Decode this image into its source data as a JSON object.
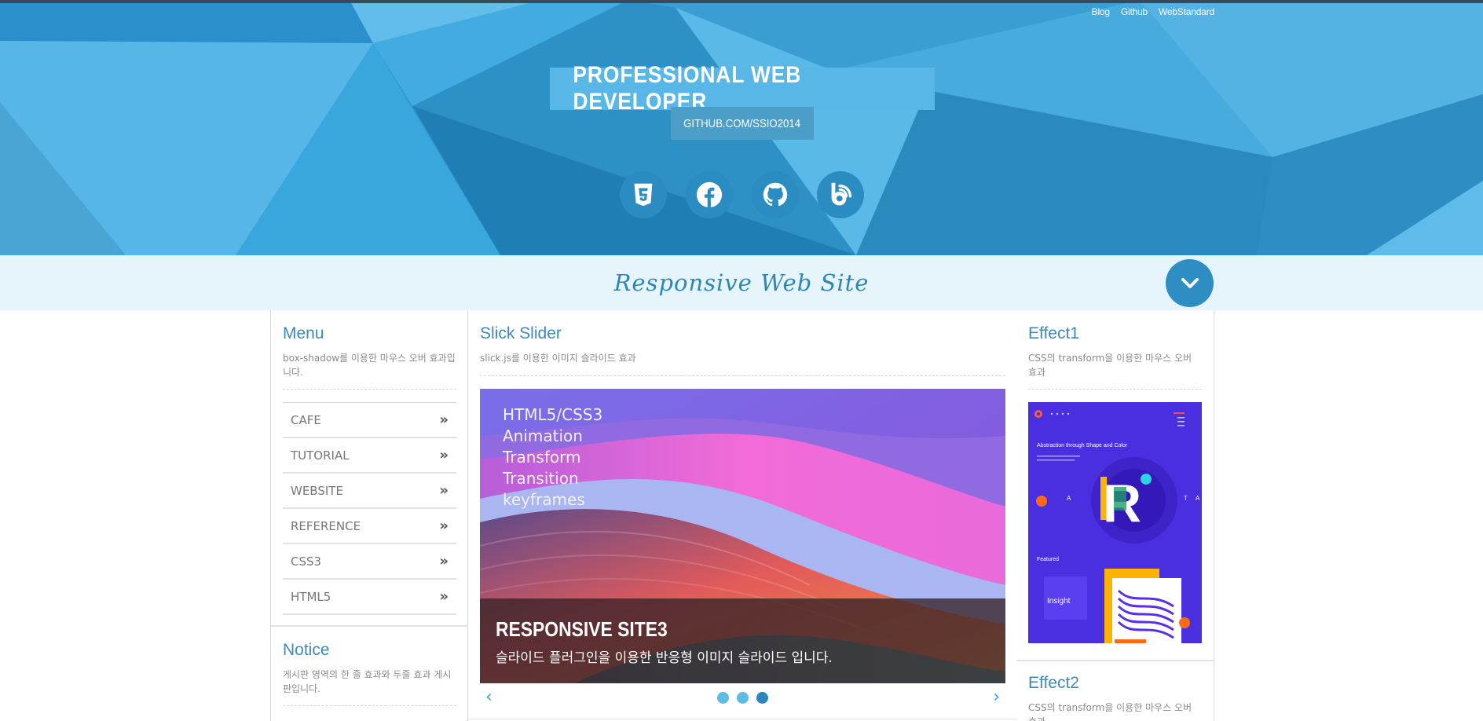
{
  "top_links": [
    "Blog",
    "Github",
    "WebStandard"
  ],
  "header": {
    "title": "PROFESSIONAL WEB DEVELOPER",
    "subtitle": "GITHUB.COM/SSIO2014",
    "social": [
      "html5-icon",
      "facebook-icon",
      "github-icon",
      "blog-icon"
    ]
  },
  "band": {
    "title": "Responsive Web Site"
  },
  "menu": {
    "title": "Menu",
    "desc": "box-shadow를 이용한 마우스 오버 효과입니다.",
    "items": [
      "CAFE",
      "TUTORIAL",
      "WEBSITE",
      "REFERENCE",
      "CSS3",
      "HTML5"
    ]
  },
  "notice": {
    "title": "Notice",
    "desc": "게시판 영역의 한 줄 효과와 두줄 효과 게시판입니다."
  },
  "slider": {
    "title": "Slick Slider",
    "desc": "slick.js를 이용한 이미지 슬라이드 효과",
    "lines": [
      "HTML5/CSS3",
      "Animation",
      "Transform",
      "Transition",
      "keyframes"
    ],
    "caption_title": "RESPONSIVE SITE3",
    "caption_desc": "슬라이드 플러그인을 이용한 반응형 이미지 슬라이드 입니다.",
    "prev": "‹",
    "next": "›",
    "dot_count": 3,
    "active_dot": 3
  },
  "effect1": {
    "title": "Effect1",
    "desc": "CSS의 transform을 이용한 마우스 오버 효과",
    "poster": {
      "heading": "Abstraction through Shape and Color",
      "letter": "R",
      "left_letter": "A",
      "right_letter": "T",
      "edge_letter": "A",
      "featured": "Featured",
      "insight": "Insight"
    }
  },
  "effect2": {
    "title": "Effect2",
    "desc": "CSS의 transform을 이용한 마우스 오버 효과"
  },
  "colors": {
    "header_blue": "#2e95cc",
    "band_bg": "#e6f5fc",
    "accent": "#3f89b9",
    "poster_bg": "#4a2fe0"
  }
}
